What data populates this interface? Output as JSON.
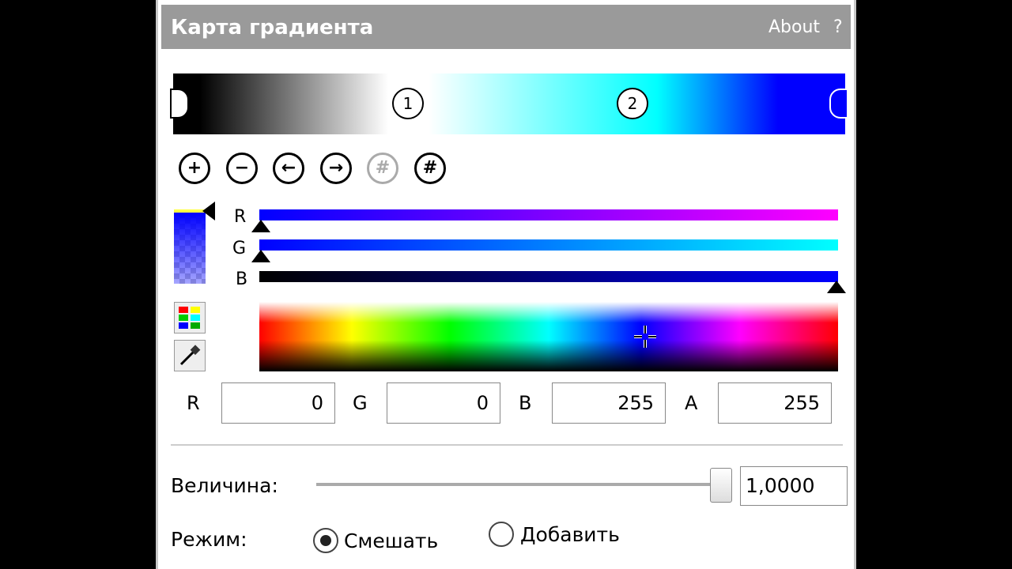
{
  "panel": {
    "title": "Карта градиента",
    "about_label": "About",
    "help_label": "?"
  },
  "gradient": {
    "stops": [
      "1",
      "2"
    ],
    "colors": [
      "#000000",
      "#ffffff",
      "#00ffff",
      "#0000ff"
    ]
  },
  "toolbar": {
    "add_icon": "plus-circle-icon",
    "remove_icon": "minus-circle-icon",
    "move_left_icon": "arrow-left-circle-icon",
    "move_right_icon": "arrow-right-circle-icon",
    "disabled_icon": "hash-circle-icon",
    "distribute_icon": "hash-down-circle-icon"
  },
  "channels": {
    "r_label": "R",
    "g_label": "G",
    "b_label": "B",
    "r_value": 0,
    "g_value": 0,
    "b_value": 255
  },
  "fields": {
    "r_label": "R",
    "r_value": "0",
    "g_label": "G",
    "g_value": "0",
    "b_label": "B",
    "b_value": "255",
    "a_label": "A",
    "a_value": "255"
  },
  "amount": {
    "label": "Величина:",
    "value": "1,0000",
    "fraction": 1.0
  },
  "mode": {
    "label": "Режим:",
    "options": [
      "Смешать",
      "Добавить"
    ],
    "selected": "Смешать"
  }
}
